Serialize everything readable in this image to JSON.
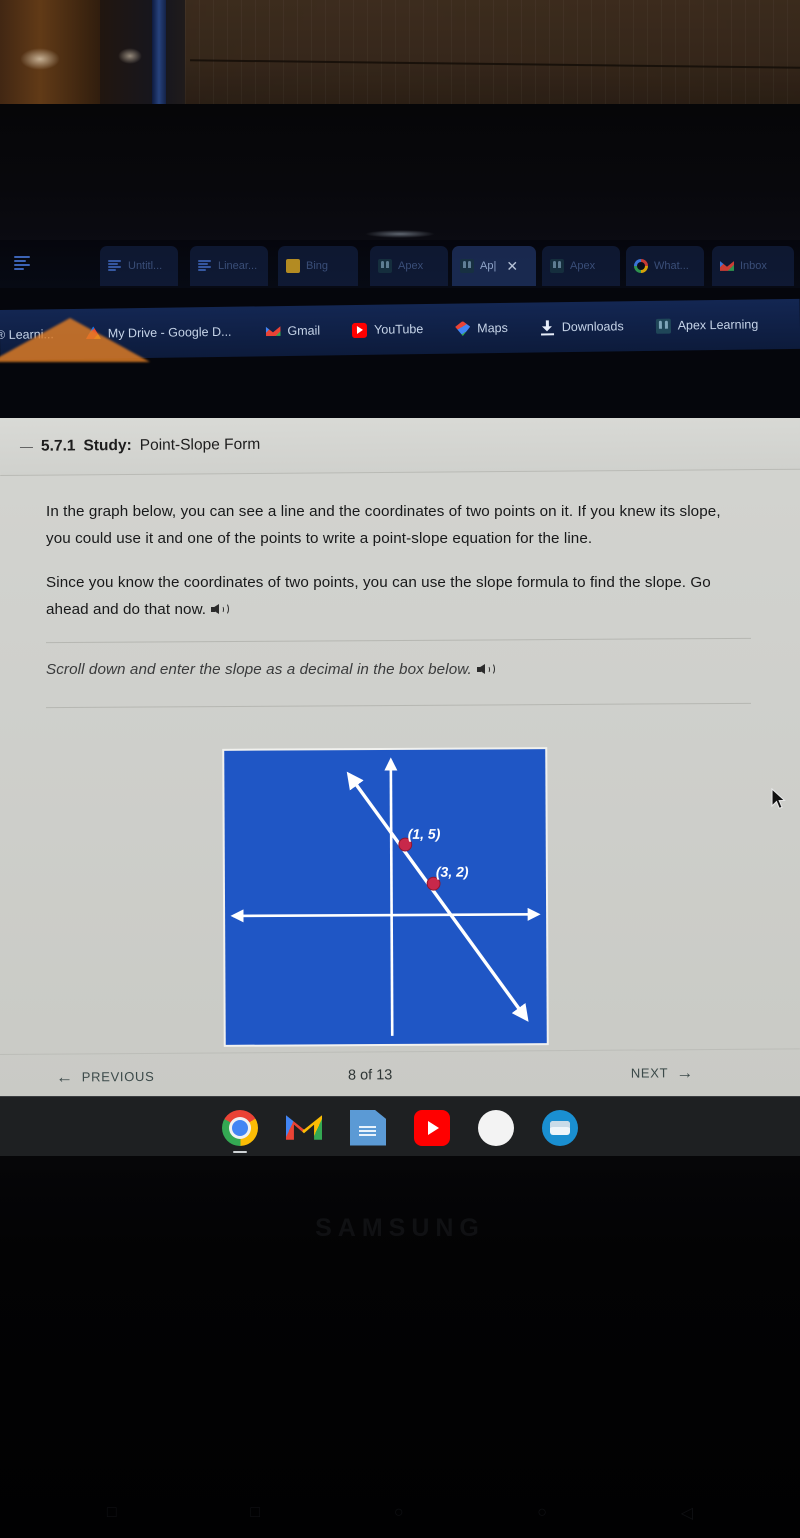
{
  "browser": {
    "tabs": [
      {
        "label": "Untitl...",
        "favicon": "document-icon",
        "active": false
      },
      {
        "label": "Linear...",
        "favicon": "document-icon",
        "active": false
      },
      {
        "label": "Bing",
        "favicon": "bing-icon",
        "active": false
      },
      {
        "label": "Apex",
        "favicon": "apex-icon",
        "active": false
      },
      {
        "label": "Ap|",
        "favicon": "apex-icon",
        "active": true
      },
      {
        "label": "Apex",
        "favicon": "apex-icon",
        "active": false
      },
      {
        "label": "What...",
        "favicon": "google-icon",
        "active": false
      },
      {
        "label": "Inbox",
        "favicon": "gmail-icon",
        "active": false
      }
    ],
    "close_glyph": "✕",
    "bookmarks": [
      {
        "label": "® Learni...",
        "favicon": "apex-icon"
      },
      {
        "label": "My Drive - Google D...",
        "favicon": "drive-icon"
      },
      {
        "label": "Gmail",
        "favicon": "gmail-icon"
      },
      {
        "label": "YouTube",
        "favicon": "youtube-icon"
      },
      {
        "label": "Maps",
        "favicon": "maps-icon"
      },
      {
        "label": "Downloads",
        "favicon": "download-icon"
      },
      {
        "label": "Apex Learning",
        "favicon": "apex-icon"
      }
    ]
  },
  "lesson": {
    "dash": "—",
    "number": "5.7.1",
    "study_label": "Study:",
    "title": "Point-Slope Form",
    "paragraph1": "In the graph below, you can see a line and the coordinates of two points on it. If you knew its slope, you could use it and one of the points to write a point-slope equation for the line.",
    "paragraph2": "Since you know the coordinates of two points, you can use the slope formula to find the slope. Go ahead and do that now.",
    "instruction": "Scroll down and enter the slope as a decimal in the box below."
  },
  "pager": {
    "previous_label": "PREVIOUS",
    "previous_arrow": "←",
    "next_label": "NEXT",
    "next_arrow": "→",
    "count": "8 of 13",
    "current_page": 8,
    "total_pages": 13
  },
  "chart_data": {
    "type": "line",
    "title": "",
    "xlabel": "",
    "ylabel": "",
    "grid": false,
    "legend": false,
    "xlim": [
      -8,
      8
    ],
    "ylim": [
      -8,
      8
    ],
    "background_color": "#1f56c5",
    "line_color": "#ffffff",
    "point_color": "#c8284a",
    "label_color": "#ffffff",
    "axes": {
      "x_arrows": "both",
      "y_arrows": "both"
    },
    "series": [
      {
        "name": "line",
        "points": [
          {
            "x": 1,
            "y": 5,
            "label": "(1, 5)"
          },
          {
            "x": 3,
            "y": 2,
            "label": "(3, 2)"
          }
        ],
        "slope": -1.5,
        "labels": [
          "(1, 5)",
          "(3, 2)"
        ]
      }
    ]
  },
  "shelf": {
    "items": [
      {
        "name": "chrome-icon",
        "label": "Chrome",
        "running": true
      },
      {
        "name": "gmail-icon",
        "label": "Gmail",
        "running": true
      },
      {
        "name": "docs-icon",
        "label": "Docs",
        "running": false
      },
      {
        "name": "youtube-icon",
        "label": "YouTube",
        "running": false
      },
      {
        "name": "play-store-icon",
        "label": "Play Store",
        "running": false
      },
      {
        "name": "messages-icon",
        "label": "Messages",
        "running": false
      }
    ]
  },
  "device": {
    "brand": "SAMSUNG",
    "nav_back": "◁",
    "nav_home": "○",
    "nav_recents": "□"
  }
}
